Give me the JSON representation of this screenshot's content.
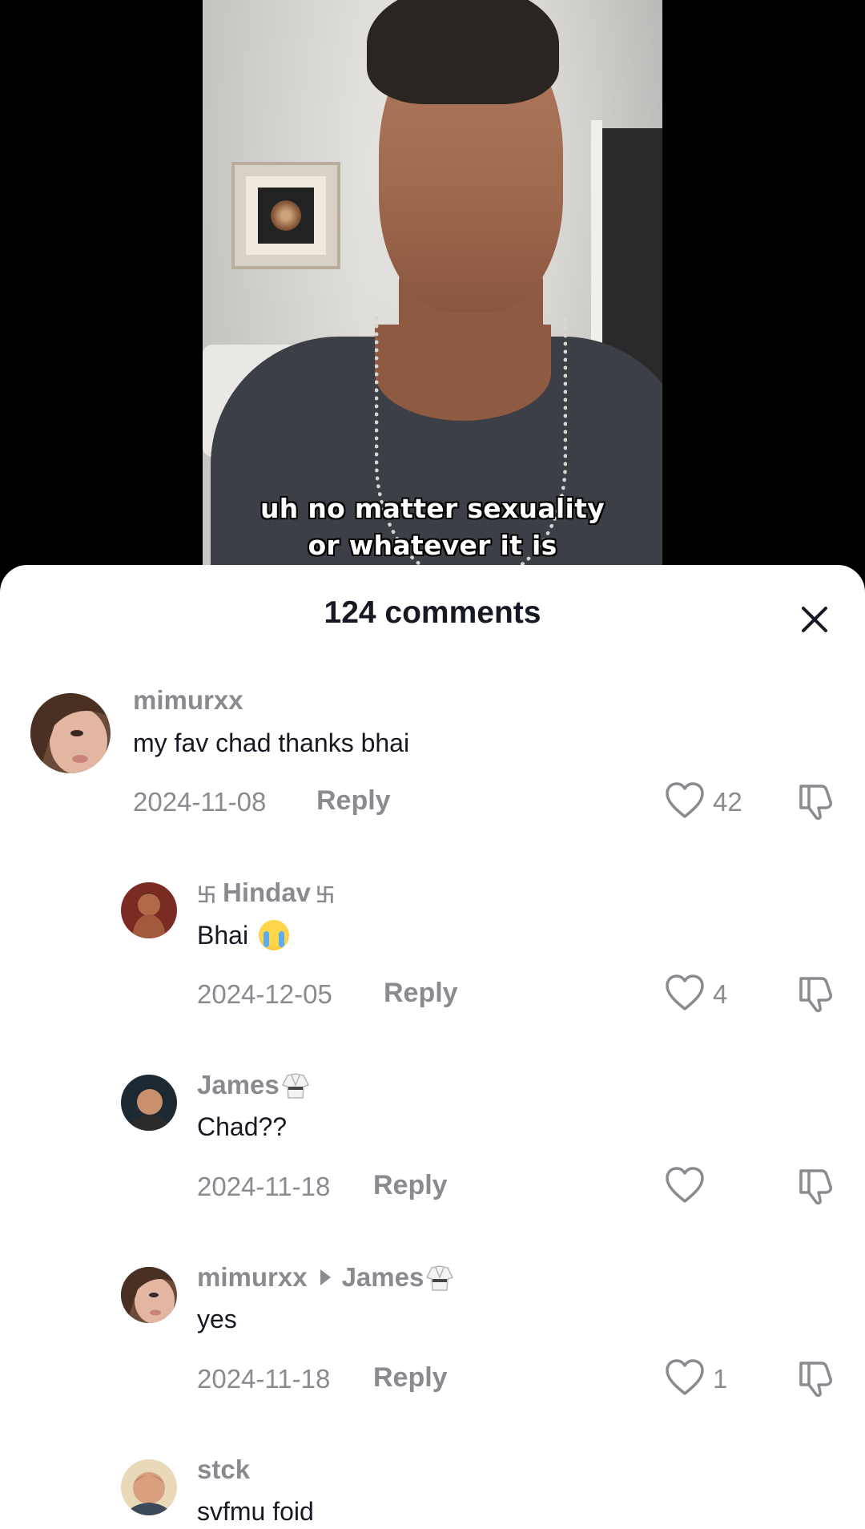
{
  "video": {
    "caption_line1": "uh no matter sexuality",
    "caption_line2": "or whatever it is"
  },
  "sheet": {
    "title": "124 comments",
    "close_icon": "close-icon"
  },
  "comments": [
    {
      "username": "mimurxx",
      "text": "my fav chad thanks bhai",
      "date": "2024-11-08",
      "reply_label": "Reply",
      "likes": "42"
    },
    {
      "username_prefix": "卐",
      "username": "Hindav",
      "username_suffix": "卐",
      "text": "Bhai",
      "text_emoji": "loudly-crying-face",
      "date": "2024-12-05",
      "reply_label": "Reply",
      "likes": "4"
    },
    {
      "username": "James",
      "username_emoji": "martial-arts-uniform",
      "text": "Chad??",
      "date": "2024-11-18",
      "reply_label": "Reply",
      "likes": ""
    },
    {
      "username": "mimurxx",
      "reply_to": "James",
      "reply_to_emoji": "martial-arts-uniform",
      "text": "yes",
      "date": "2024-11-18",
      "reply_label": "Reply",
      "likes": "1"
    },
    {
      "username": "stck",
      "text": "svfmu foid"
    }
  ],
  "colors": {
    "sheet_bg": "#ffffff",
    "secondary_text": "#8a8b91",
    "primary_text": "#161823"
  }
}
